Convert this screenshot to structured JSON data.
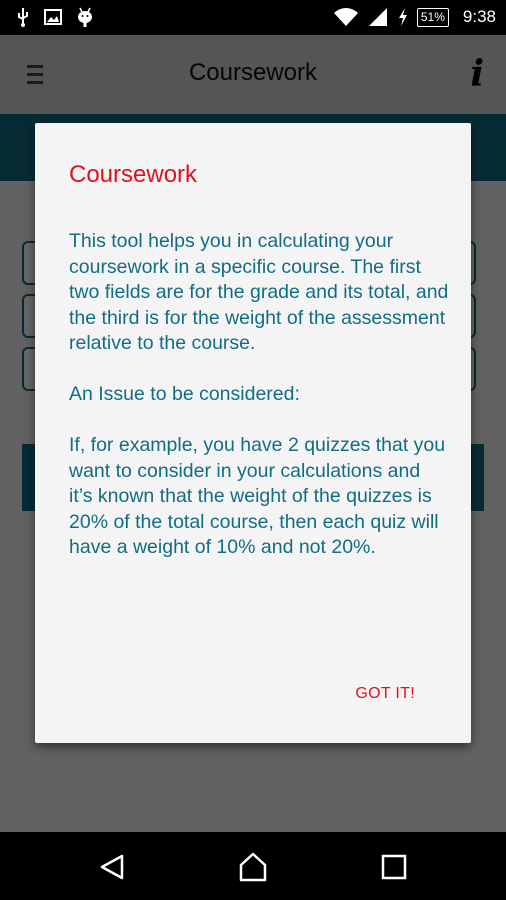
{
  "status_bar": {
    "icons_left": [
      "usb-icon",
      "image-icon",
      "android-icon"
    ],
    "icons_right": [
      "wifi-icon",
      "signal-icon",
      "charging-icon"
    ],
    "battery": "51%",
    "time": "9:38"
  },
  "toolbar": {
    "title": "Coursework",
    "menu_icon": "hamburger-menu-icon",
    "info_icon": "info-icon",
    "info_glyph": "i"
  },
  "dialog": {
    "title": "Coursework",
    "paragraphs": [
      "This tool helps you in calculating your coursework in a specific course. The first two fields are for the grade and its total, and the third is for the weight of the assessment relative to the course.",
      "An Issue to be considered:",
      "If, for example, you have 2 quizzes that you want to consider in your calculations and it’s known that the weight of the quizzes is 20% of the total course, then each quiz will have a weight of 10% and not 20%."
    ],
    "confirm_label": "GOT IT!"
  },
  "nav_bar": {
    "back": "back-icon",
    "home": "home-icon",
    "recents": "recents-icon"
  },
  "colors": {
    "accent_red": "#e0121f",
    "primary_teal": "#136d82",
    "dialog_bg": "#f4f4f4"
  }
}
